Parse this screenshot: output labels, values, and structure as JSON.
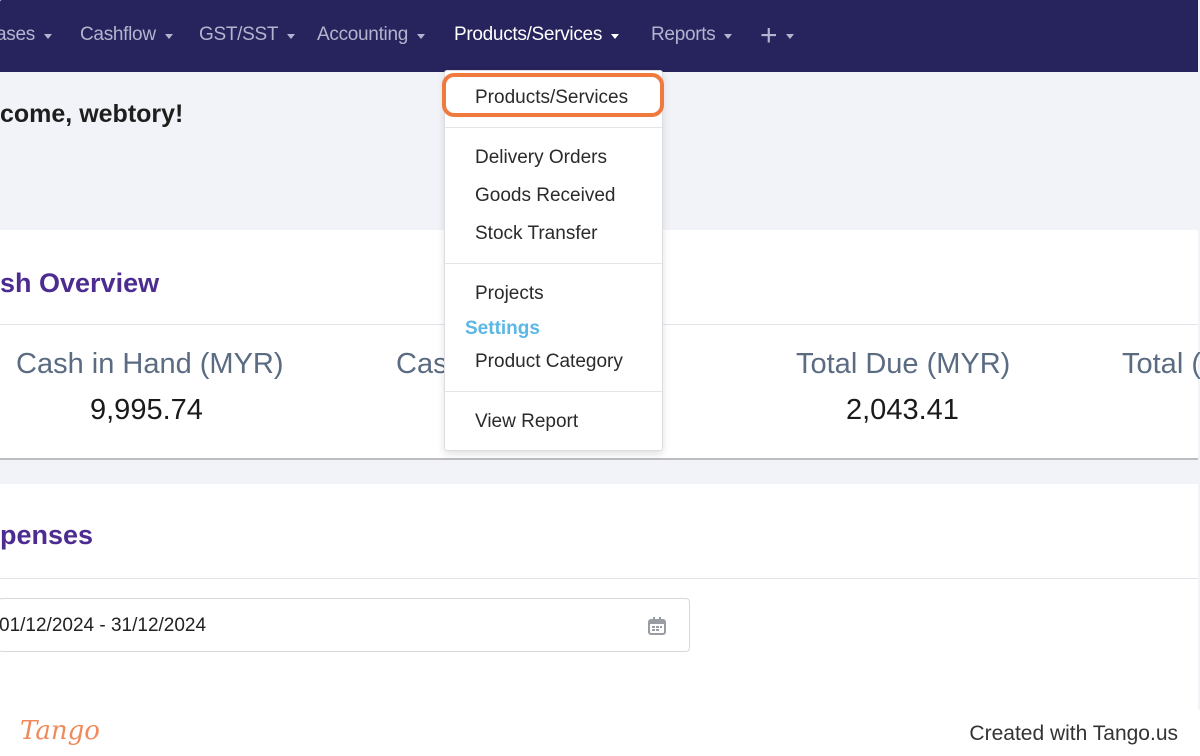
{
  "nav": {
    "items": [
      {
        "label": "ases",
        "active": false
      },
      {
        "label": "Cashflow",
        "active": false
      },
      {
        "label": "GST/SST",
        "active": false
      },
      {
        "label": "Accounting",
        "active": false
      },
      {
        "label": "Products/Services",
        "active": true
      },
      {
        "label": "Reports",
        "active": false
      }
    ],
    "add_icon": "plus-icon",
    "background_color": "#27235c"
  },
  "welcome": {
    "text": "come, webtory!"
  },
  "cash_overview": {
    "title": "sh Overview",
    "stats": [
      {
        "label": "Cash in Hand (MYR)",
        "value": "9,995.74"
      },
      {
        "label": "Cas",
        "value": ""
      },
      {
        "label": "Total Due (MYR)",
        "value": "2,043.41"
      },
      {
        "label": "Total (",
        "value": ""
      }
    ]
  },
  "expenses": {
    "title": "penses",
    "date_range": "01/12/2024 - 31/12/2024",
    "calendar_icon": "calendar-icon"
  },
  "dropdown": {
    "primary": "Products/Services",
    "group1": [
      "Delivery Orders",
      "Goods Received",
      "Stock Transfer"
    ],
    "projects": "Projects",
    "settings_header": "Settings",
    "product_category": "Product Category",
    "view_report": "View Report",
    "highlight_color": "#f07a3d",
    "settings_color": "#5ab7e6"
  },
  "footer": {
    "logo": "Tango",
    "credit": "Created with Tango.us"
  }
}
